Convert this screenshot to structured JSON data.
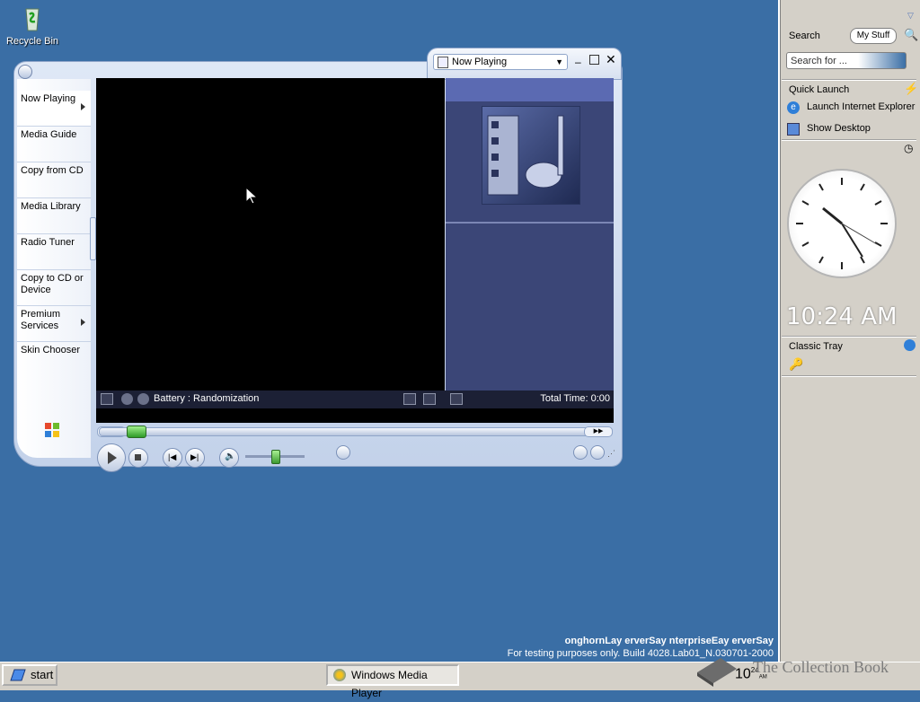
{
  "desktop": {
    "recycle_bin_label": "Recycle Bin"
  },
  "wmp": {
    "now_playing_dropdown": "Now Playing",
    "taskpane": [
      {
        "label": "Now Playing",
        "has_arrow": true
      },
      {
        "label": "Media Guide"
      },
      {
        "label": "Copy from CD"
      },
      {
        "label": "Media Library"
      },
      {
        "label": "Radio Tuner"
      },
      {
        "label": "Copy to CD or Device"
      },
      {
        "label": "Premium Services",
        "has_arrow": true
      },
      {
        "label": "Skin Chooser"
      }
    ],
    "info_text": "Battery : Randomization",
    "total_time": "Total Time: 0:00",
    "volume_level": 0.5,
    "seek_position": 0.06
  },
  "sidebar": {
    "search_label": "Search",
    "my_stuff": "My Stuff",
    "search_placeholder": "Search for ...",
    "quick_launch": "Quick Launch",
    "launch_ie": "Launch Internet Explorer",
    "show_desktop": "Show Desktop",
    "clock_time": "10:24 AM",
    "classic_tray": "Classic Tray"
  },
  "taskbar": {
    "start": "start",
    "task_wmp": "Windows Media Player",
    "tray_time": "10",
    "tray_time_small": "24",
    "tray_ampm": "AM"
  },
  "build_info": {
    "line1": "onghornLay erverSay nterpriseEay erverSay",
    "line2": "For testing purposes only. Build 4028.Lab01_N.030701-2000"
  },
  "watermark": "The Collection Book",
  "colors": {
    "desktop": "#3a6ea5",
    "sidebar": "#d4d0c8",
    "viz_panel": "#3b4677"
  }
}
